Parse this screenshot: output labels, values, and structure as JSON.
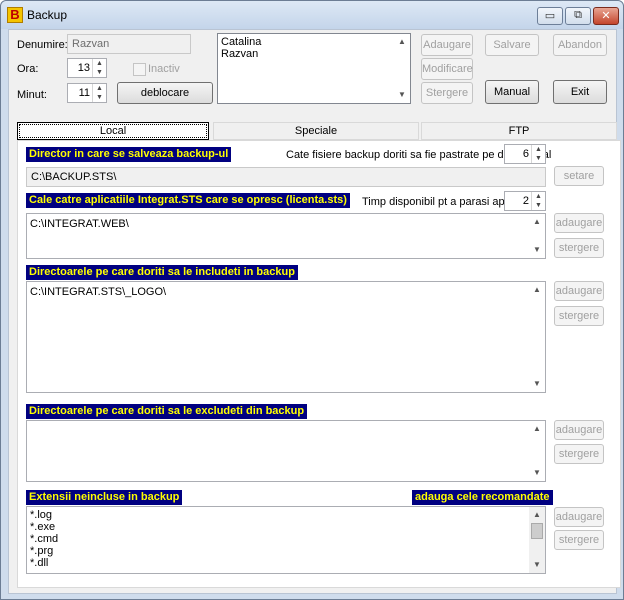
{
  "window": {
    "title": "Backup",
    "app_icon": "B",
    "minimize_glyph": "▭",
    "restore_glyph": "⧉",
    "close_glyph": "✕"
  },
  "header": {
    "name_label": "Denumire:",
    "name_value": "Razvan",
    "hour_label": "Ora:",
    "hour_value": "13",
    "minute_label": "Minut:",
    "minute_value": "11",
    "inactive_label": "Inactiv",
    "unlock_button": "deblocare",
    "users": [
      "Catalina",
      "Razvan"
    ],
    "buttons": {
      "add": "Adaugare",
      "modify": "Modificare",
      "delete": "Stergere",
      "save": "Salvare",
      "abandon": "Abandon",
      "manual": "Manual",
      "exit": "Exit"
    }
  },
  "tabs": [
    "Local",
    "Speciale",
    "FTP"
  ],
  "local": {
    "backup_dir": {
      "title": "Director in care se salveaza backup-ul",
      "keep_label": "Cate fisiere backup doriti sa fie pastrate pe discul local",
      "keep_value": "6",
      "path": "C:\\BACKUP.STS\\",
      "set_button": "setare"
    },
    "apps": {
      "title": "Cale catre aplicatiile Integrat.STS care se opresc (licenta.sts)",
      "time_label": "Timp disponibil pt a parasi aplicatia",
      "time_value": "2",
      "lines": [
        "C:\\INTEGRAT.WEB\\"
      ],
      "add_button": "adaugare",
      "delete_button": "stergere"
    },
    "include": {
      "title": "Directoarele pe care doriti sa le includeti in backup",
      "lines": [
        "C:\\INTEGRAT.STS\\_LOGO\\"
      ],
      "add_button": "adaugare",
      "delete_button": "stergere"
    },
    "exclude": {
      "title": "Directoarele pe care doriti sa le excludeti din backup",
      "lines": [],
      "add_button": "adaugare",
      "delete_button": "stergere"
    },
    "extensions": {
      "title": "Extensii neincluse in backup",
      "recommended_button": "adauga cele recomandate",
      "lines": [
        "*.log",
        "*.exe",
        "*.cmd",
        "*.prg",
        "*.dll"
      ],
      "add_button": "adaugare",
      "delete_button": "stergere"
    }
  }
}
